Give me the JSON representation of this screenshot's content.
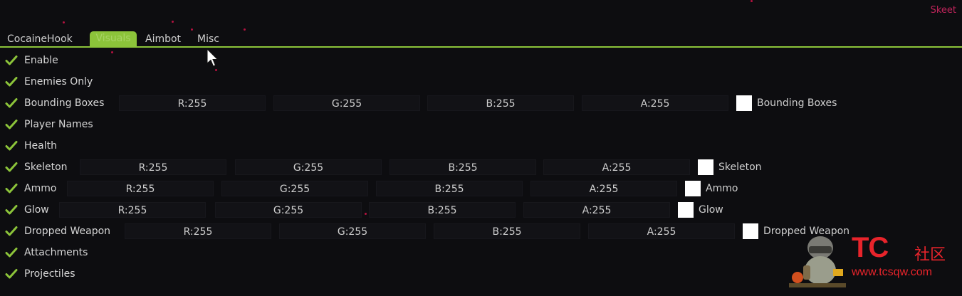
{
  "brand": "Skeet",
  "tabs": [
    {
      "label": "CocaineHook",
      "active": false
    },
    {
      "label": "Visuals",
      "active": true
    },
    {
      "label": "Aimbot",
      "active": false
    },
    {
      "label": "Misc",
      "active": false
    }
  ],
  "options": [
    {
      "label": "Enable",
      "checked": true
    },
    {
      "label": "Enemies Only",
      "checked": true
    },
    {
      "label": "Bounding Boxes",
      "checked": true,
      "color": {
        "r": "R:255",
        "g": "G:255",
        "b": "B:255",
        "a": "A:255",
        "swatch": "#ffffff",
        "swatch_label": "Bounding Boxes"
      }
    },
    {
      "label": "Player Names",
      "checked": true
    },
    {
      "label": "Health",
      "checked": true
    },
    {
      "label": "Skeleton",
      "checked": true,
      "color": {
        "r": "R:255",
        "g": "G:255",
        "b": "B:255",
        "a": "A:255",
        "swatch": "#ffffff",
        "swatch_label": "Skeleton"
      }
    },
    {
      "label": "Ammo",
      "checked": true,
      "color": {
        "r": "R:255",
        "g": "G:255",
        "b": "B:255",
        "a": "A:255",
        "swatch": "#ffffff",
        "swatch_label": "Ammo"
      }
    },
    {
      "label": "Glow",
      "checked": true,
      "color": {
        "r": "R:255",
        "g": "G:255",
        "b": "B:255",
        "a": "A:255",
        "swatch": "#ffffff",
        "swatch_label": "Glow"
      }
    },
    {
      "label": "Dropped Weapon",
      "checked": true,
      "color": {
        "r": "R:255",
        "g": "G:255",
        "b": "B:255",
        "a": "A:255",
        "swatch": "#ffffff",
        "swatch_label": "Dropped Weapon"
      }
    },
    {
      "label": "Attachments",
      "checked": true
    },
    {
      "label": "Projectiles",
      "checked": true
    }
  ],
  "watermark": {
    "logo": "TC",
    "text": "社区",
    "url": "www.tcsqw.com"
  },
  "colors": {
    "accent": "#8cc43a",
    "brand": "#c0245b",
    "background": "#0d0d10",
    "watermark_red": "#e8242b"
  }
}
